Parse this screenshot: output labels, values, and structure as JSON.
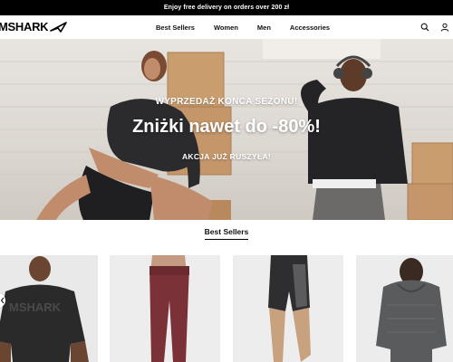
{
  "promo": {
    "text": "Enjoy free delivery on orders over 200 zł"
  },
  "header": {
    "logo_text": "MSHARK",
    "nav": [
      "Best Sellers",
      "Women",
      "Men",
      "Accessories"
    ],
    "icons": [
      "search-icon",
      "account-icon"
    ]
  },
  "hero": {
    "kicker": "WYPRZEDAŻ KONCA SEZONU!",
    "title": "Zniżki nawet do -80%!",
    "subtitle": "AKCJA JUŻ RUSZYŁA!"
  },
  "best_sellers": {
    "title": "Best Sellers",
    "cards": [
      {
        "name": "black-tshirt-card",
        "print": "MSHARK"
      },
      {
        "name": "burgundy-leggings-card"
      },
      {
        "name": "shorts-card"
      },
      {
        "name": "grey-hoodie-card"
      }
    ]
  },
  "colors": {
    "promo_bg": "#000000",
    "accent": "#000000",
    "card_bg": "#ececec"
  }
}
